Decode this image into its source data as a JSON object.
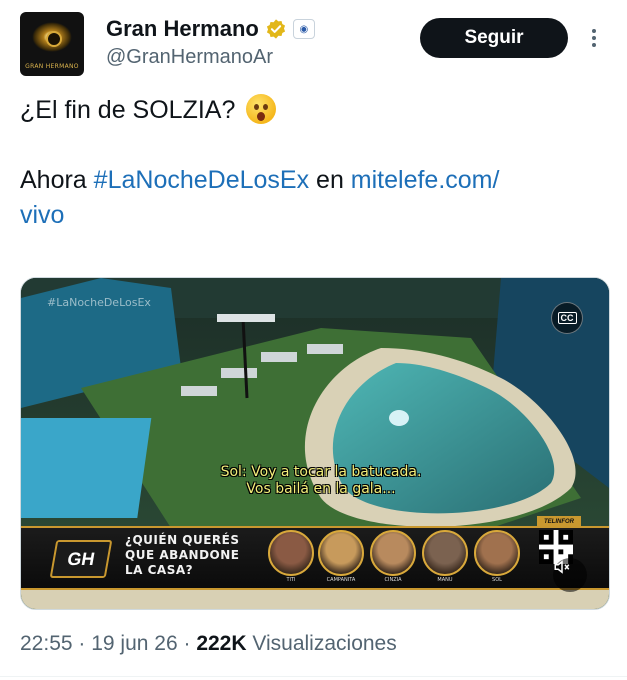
{
  "account": {
    "display_name": "Gran Hermano",
    "handle": "@GranHermanoAr",
    "avatar_text": "GRAN HERMANO",
    "verified_icon": "gold-verified-badge-icon",
    "affiliate_icon": "affiliate-badge-icon"
  },
  "actions": {
    "follow_label": "Seguir",
    "more_icon": "more-options-icon"
  },
  "tweet": {
    "line1": "¿El fin de SOLZIA?",
    "line1_emoji": "hushed-face-emoji",
    "line2_prefix": "Ahora ",
    "hashtag": "#LaNocheDeLosEx",
    "line2_mid": " en ",
    "link": "mitelefe.com/\nvivo"
  },
  "media": {
    "watermark": "#LaNocheDeLosEx",
    "cc_label": "CC",
    "subtitle_line1": "Sol: Voy a tocar la batucada.",
    "subtitle_line2": "Vos bailá en la gala...",
    "gh_logo": "GH",
    "question": "¿QUIÉN QUERÉS\nQUE ABANDONE\nLA CASA?",
    "nominees": [
      {
        "name": "TITI",
        "color": "#8a5a44"
      },
      {
        "name": "CAMPANITA",
        "color": "#c79a5c"
      },
      {
        "name": "CINZIA",
        "color": "#b88a5e"
      },
      {
        "name": "MANU",
        "color": "#7b6250"
      },
      {
        "name": "SOL",
        "color": "#a0714e"
      }
    ],
    "sponsor": "TELINFOR",
    "mute_icon": "speaker-muted-icon"
  },
  "footer": {
    "time": "22:55",
    "sep1": " · ",
    "date": "19 jun 26",
    "sep2": " · ",
    "views": "222K",
    "views_label": " Visualizaciones"
  }
}
